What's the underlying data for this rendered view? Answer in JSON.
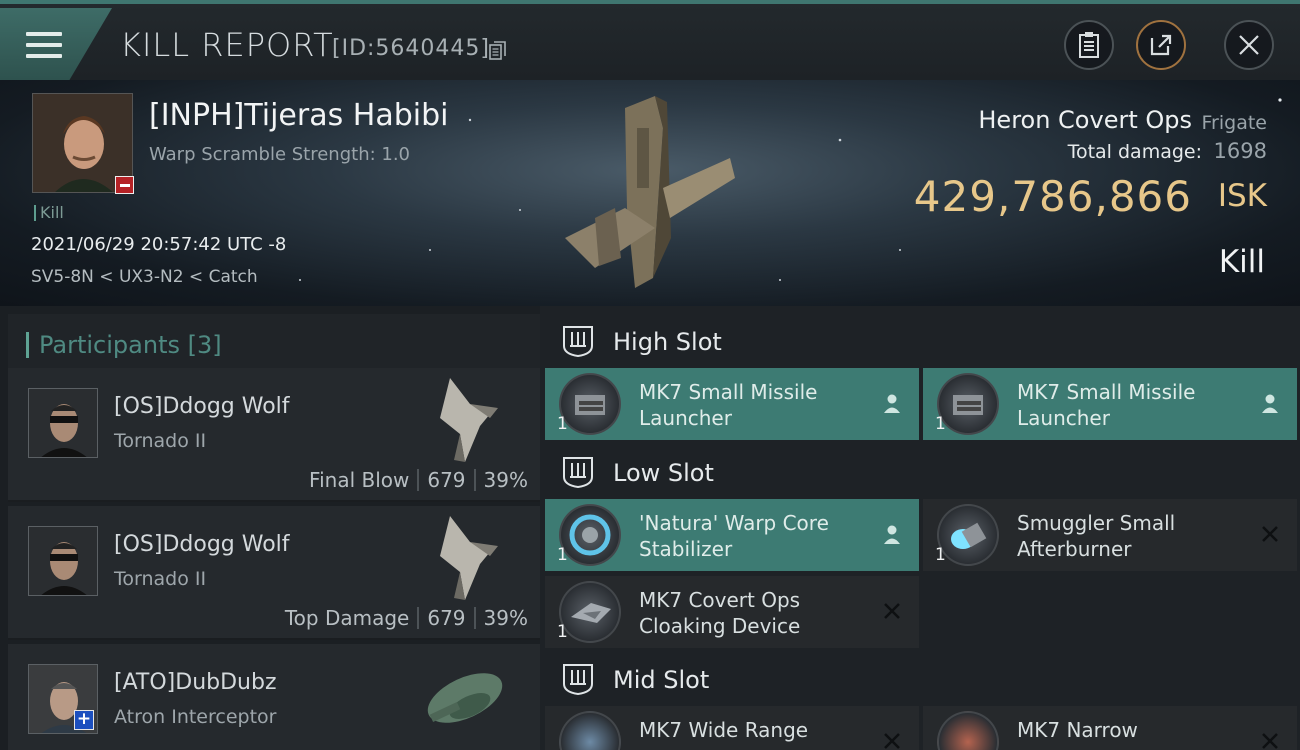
{
  "header": {
    "title": "KILL REPORT",
    "report_id": "[ID:5640445]"
  },
  "victim": {
    "name": "[INPH]Tijeras Habibi",
    "warp_scramble": "Warp Scramble Strength: 1.0",
    "kill_tag": "Kill",
    "datetime": "2021/06/29 20:57:42 UTC -8",
    "route": "SV5-8N < UX3-N2 < Catch",
    "ship_name": "Heron Covert Ops",
    "ship_class": "Frigate",
    "total_damage_label": "Total damage:",
    "total_damage": "1698",
    "isk_value": "429,786,866",
    "isk_unit": "ISK",
    "result": "Kill"
  },
  "participants": {
    "label": "Participants",
    "count": "[3]",
    "items": [
      {
        "name": "[OS]Ddogg Wolf",
        "ship": "Tornado II",
        "role": "Final Blow",
        "damage": "679",
        "percent": "39%"
      },
      {
        "name": "[OS]Ddogg Wolf",
        "ship": "Tornado II",
        "role": "Top Damage",
        "damage": "679",
        "percent": "39%"
      },
      {
        "name": "[ATO]DubDubz",
        "ship": "Atron Interceptor"
      }
    ]
  },
  "fitting": {
    "high": {
      "label": "High Slot",
      "modules": [
        {
          "name": "MK7 Small Missile Launcher",
          "qty": "1",
          "state": "dropped",
          "icon": "missile-launcher-icon"
        },
        {
          "name": "MK7 Small Missile Launcher",
          "qty": "1",
          "state": "dropped",
          "icon": "missile-launcher-icon"
        }
      ]
    },
    "low": {
      "label": "Low Slot",
      "modules": [
        {
          "name": "'Natura' Warp Core Stabilizer",
          "qty": "1",
          "state": "dropped",
          "icon": "warp-core-stabilizer-icon"
        },
        {
          "name": "Smuggler Small Afterburner",
          "qty": "1",
          "state": "destroyed",
          "icon": "afterburner-icon"
        },
        {
          "name": "MK7 Covert Ops Cloaking Device",
          "qty": "1",
          "state": "destroyed",
          "icon": "cloaking-device-icon"
        }
      ]
    },
    "mid": {
      "label": "Mid Slot",
      "modules": [
        {
          "name": "MK7 Wide Range",
          "state": "destroyed",
          "icon": "target-painter-icon"
        },
        {
          "name": "MK7 Narrow",
          "state": "destroyed",
          "icon": "scrambler-icon"
        }
      ]
    }
  },
  "colors": {
    "accent": "#3d7b73",
    "isk_gold": "#e7c78a",
    "loss_red": "#b52226"
  }
}
